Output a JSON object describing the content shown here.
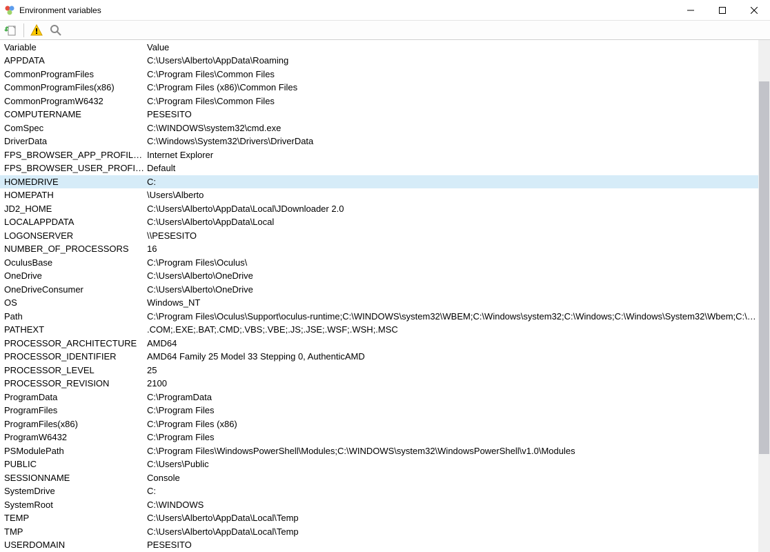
{
  "window": {
    "title": "Environment variables"
  },
  "toolbar": {
    "import_tooltip": "Import",
    "warning_tooltip": "Warning",
    "search_tooltip": "Search"
  },
  "headers": {
    "variable": "Variable",
    "value": "Value"
  },
  "selected_index": 9,
  "rows": [
    {
      "variable": "APPDATA",
      "value": "C:\\Users\\Alberto\\AppData\\Roaming"
    },
    {
      "variable": "CommonProgramFiles",
      "value": "C:\\Program Files\\Common Files"
    },
    {
      "variable": "CommonProgramFiles(x86)",
      "value": "C:\\Program Files (x86)\\Common Files"
    },
    {
      "variable": "CommonProgramW6432",
      "value": "C:\\Program Files\\Common Files"
    },
    {
      "variable": "COMPUTERNAME",
      "value": "PESESITO"
    },
    {
      "variable": "ComSpec",
      "value": "C:\\WINDOWS\\system32\\cmd.exe"
    },
    {
      "variable": "DriverData",
      "value": "C:\\Windows\\System32\\Drivers\\DriverData"
    },
    {
      "variable": "FPS_BROWSER_APP_PROFILE_STRING",
      "value": "Internet Explorer"
    },
    {
      "variable": "FPS_BROWSER_USER_PROFILE_STRING",
      "value": "Default"
    },
    {
      "variable": "HOMEDRIVE",
      "value": "C:"
    },
    {
      "variable": "HOMEPATH",
      "value": "\\Users\\Alberto"
    },
    {
      "variable": "JD2_HOME",
      "value": "C:\\Users\\Alberto\\AppData\\Local\\JDownloader 2.0"
    },
    {
      "variable": "LOCALAPPDATA",
      "value": "C:\\Users\\Alberto\\AppData\\Local"
    },
    {
      "variable": "LOGONSERVER",
      "value": "\\\\PESESITO"
    },
    {
      "variable": "NUMBER_OF_PROCESSORS",
      "value": "16"
    },
    {
      "variable": "OculusBase",
      "value": "C:\\Program Files\\Oculus\\"
    },
    {
      "variable": "OneDrive",
      "value": "C:\\Users\\Alberto\\OneDrive"
    },
    {
      "variable": "OneDriveConsumer",
      "value": "C:\\Users\\Alberto\\OneDrive"
    },
    {
      "variable": "OS",
      "value": "Windows_NT"
    },
    {
      "variable": "Path",
      "value": "C:\\Program Files\\Oculus\\Support\\oculus-runtime;C:\\WINDOWS\\system32\\WBEM;C:\\Windows\\system32;C:\\Windows;C:\\Windows\\System32\\Wbem;C:\\Windows\\..."
    },
    {
      "variable": "PATHEXT",
      "value": ".COM;.EXE;.BAT;.CMD;.VBS;.VBE;.JS;.JSE;.WSF;.WSH;.MSC"
    },
    {
      "variable": "PROCESSOR_ARCHITECTURE",
      "value": "AMD64"
    },
    {
      "variable": "PROCESSOR_IDENTIFIER",
      "value": "AMD64 Family 25 Model 33 Stepping 0, AuthenticAMD"
    },
    {
      "variable": "PROCESSOR_LEVEL",
      "value": "25"
    },
    {
      "variable": "PROCESSOR_REVISION",
      "value": "2100"
    },
    {
      "variable": "ProgramData",
      "value": "C:\\ProgramData"
    },
    {
      "variable": "ProgramFiles",
      "value": "C:\\Program Files"
    },
    {
      "variable": "ProgramFiles(x86)",
      "value": "C:\\Program Files (x86)"
    },
    {
      "variable": "ProgramW6432",
      "value": "C:\\Program Files"
    },
    {
      "variable": "PSModulePath",
      "value": "C:\\Program Files\\WindowsPowerShell\\Modules;C:\\WINDOWS\\system32\\WindowsPowerShell\\v1.0\\Modules"
    },
    {
      "variable": "PUBLIC",
      "value": "C:\\Users\\Public"
    },
    {
      "variable": "SESSIONNAME",
      "value": "Console"
    },
    {
      "variable": "SystemDrive",
      "value": "C:"
    },
    {
      "variable": "SystemRoot",
      "value": "C:\\WINDOWS"
    },
    {
      "variable": "TEMP",
      "value": "C:\\Users\\Alberto\\AppData\\Local\\Temp"
    },
    {
      "variable": "TMP",
      "value": "C:\\Users\\Alberto\\AppData\\Local\\Temp"
    },
    {
      "variable": "USERDOMAIN",
      "value": "PESESITO"
    }
  ]
}
